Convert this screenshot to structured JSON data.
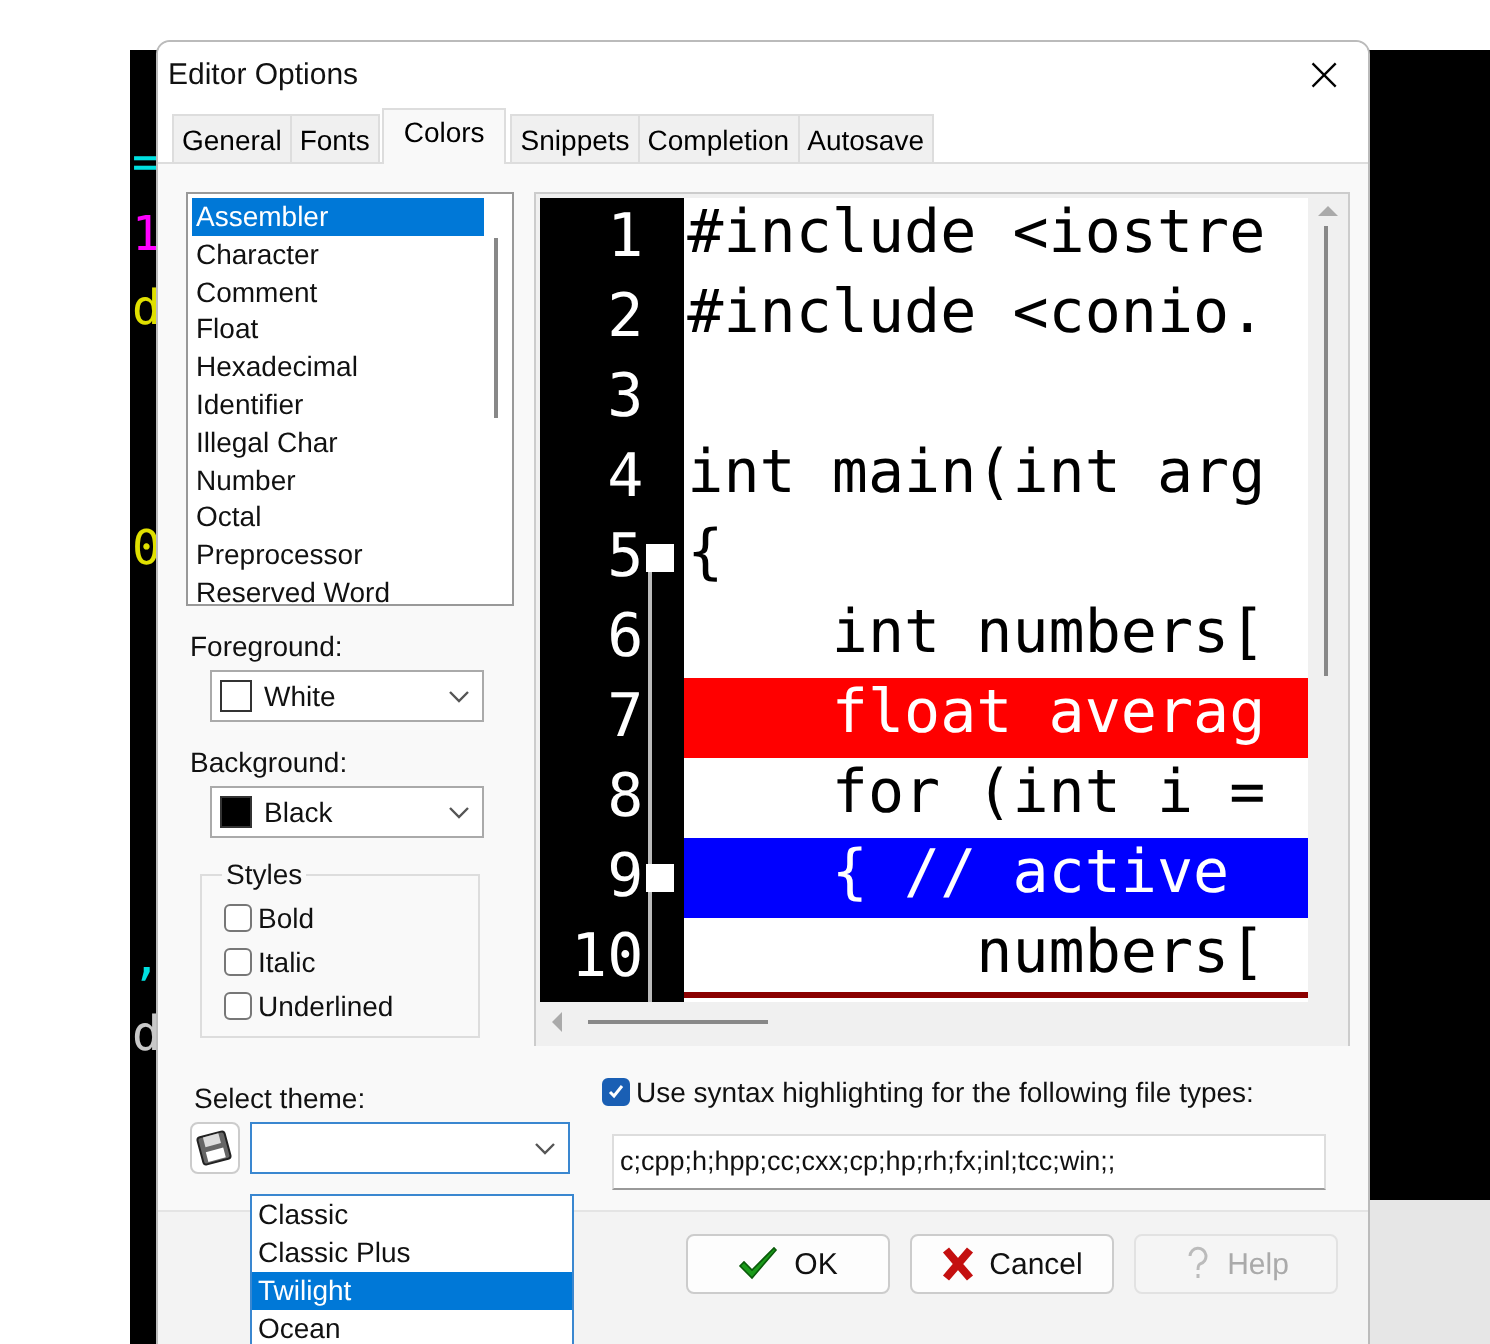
{
  "background_editor": {
    "chars": [
      {
        "text": "=",
        "color": "#00e0e0"
      },
      {
        "text": "1",
        "color": "#ff00ff"
      },
      {
        "text": "d",
        "color": "#e0e000"
      },
      {
        "text": "0",
        "color": "#e0e000"
      },
      {
        "text": ",",
        "color": "#00e0e0"
      },
      {
        "text": "d",
        "color": "#c8c8c8"
      }
    ]
  },
  "window": {
    "title": "Editor Options",
    "close": "×"
  },
  "tabs": [
    {
      "label": "General",
      "selected": false
    },
    {
      "label": "Fonts",
      "selected": false
    },
    {
      "label": "Colors",
      "selected": true
    },
    {
      "label": "Snippets",
      "selected": false
    },
    {
      "label": "Completion",
      "selected": false
    },
    {
      "label": "Autosave",
      "selected": false
    }
  ],
  "elements": [
    {
      "label": "Assembler",
      "selected": true
    },
    {
      "label": "Character",
      "selected": false
    },
    {
      "label": "Comment",
      "selected": false
    },
    {
      "label": "Float",
      "selected": false
    },
    {
      "label": "Hexadecimal",
      "selected": false
    },
    {
      "label": "Identifier",
      "selected": false
    },
    {
      "label": "Illegal Char",
      "selected": false
    },
    {
      "label": "Number",
      "selected": false
    },
    {
      "label": "Octal",
      "selected": false
    },
    {
      "label": "Preprocessor",
      "selected": false
    },
    {
      "label": "Reserved Word",
      "selected": false
    }
  ],
  "foreground": {
    "label": "Foreground:",
    "value": "White",
    "color": "#ffffff"
  },
  "background": {
    "label": "Background:",
    "value": "Black",
    "color": "#000000"
  },
  "styles": {
    "title": "Styles",
    "options": [
      {
        "label": "Bold",
        "checked": false
      },
      {
        "label": "Italic",
        "checked": false
      },
      {
        "label": "Underlined",
        "checked": false
      }
    ]
  },
  "preview": {
    "lines": [
      {
        "number": "1",
        "code": "#include <iostre",
        "kind": "plain",
        "fold_marker": false
      },
      {
        "number": "2",
        "code": "#include <conio.",
        "kind": "plain",
        "fold_marker": false
      },
      {
        "number": "3",
        "kind": "plain",
        "fold_marker": false
      },
      {
        "number": "4",
        "code": "int main(int arg",
        "kind": "plain",
        "fold_marker": false
      },
      {
        "number": "5",
        "code": "{",
        "kind": "plain",
        "fold_marker": true
      },
      {
        "number": "6",
        "code": "    int numbers[",
        "kind": "plain",
        "fold_marker": false
      },
      {
        "number": "7",
        "code": "    float averag",
        "kind": "error",
        "fold_marker": false
      },
      {
        "number": "8",
        "code": "    for (int i =",
        "kind": "plain",
        "fold_marker": false
      },
      {
        "number": "9",
        "code": "    { // active",
        "kind": "active",
        "fold_marker": true
      },
      {
        "number": "10",
        "code": "        numbers[",
        "kind": "underline",
        "fold_marker": false
      }
    ]
  },
  "theme": {
    "label": "Select theme:",
    "options": [
      {
        "label": "Classic",
        "selected": false
      },
      {
        "label": "Classic Plus",
        "selected": false
      },
      {
        "label": "Twilight",
        "selected": true
      },
      {
        "label": "Ocean",
        "selected": false
      }
    ]
  },
  "syntax": {
    "label": "Use syntax highlighting for the following file types:",
    "checked": true,
    "file_types": "c;cpp;h;hpp;cc;cxx;cp;hp;rh;fx;inl;tcc;win;;"
  },
  "buttons": [
    {
      "kind": "ok",
      "label": "OK",
      "disabled": false
    },
    {
      "kind": "cancel",
      "label": "Cancel",
      "disabled": false
    },
    {
      "kind": "help",
      "label": "Help",
      "disabled": true
    }
  ]
}
